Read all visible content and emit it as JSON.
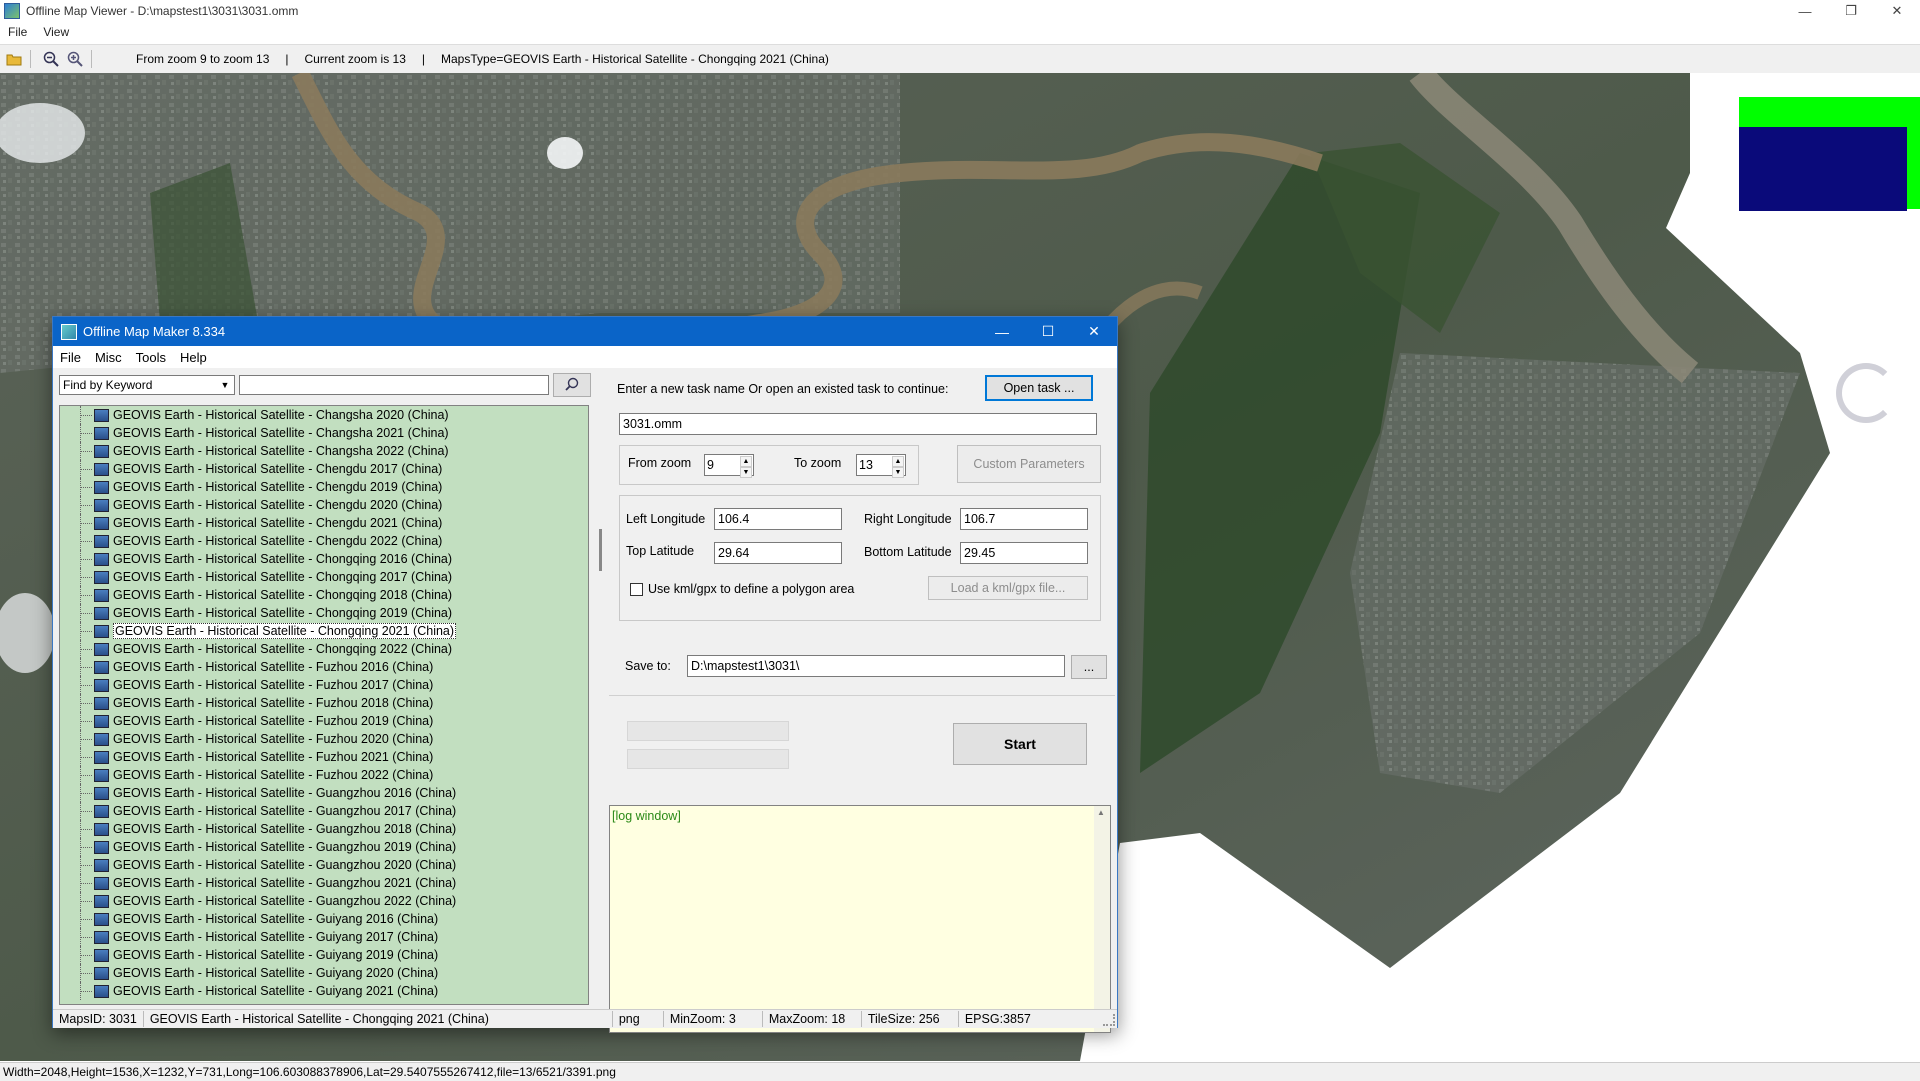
{
  "viewer": {
    "title": "Offline Map Viewer - D:\\mapstest1\\3031\\3031.omm",
    "window_buttons": {
      "minimize": "—",
      "restore": "❐",
      "close": "✕"
    },
    "menu": [
      "File",
      "View"
    ],
    "toolbar": {
      "zoom_range": "From zoom 9 to zoom 13",
      "sep1": "|",
      "current_zoom": "Current zoom is 13",
      "sep2": "|",
      "maps_type": "MapsType=GEOVIS Earth - Historical Satellite - Chongqing 2021 (China)"
    },
    "status": "Width=2048,Height=1536,X=1232,Y=731,Long=106.603088378906,Lat=29.5407555267412,file=13/6521/3391.png"
  },
  "dialog": {
    "title": "Offline Map Maker 8.334",
    "menu": [
      "File",
      "Misc",
      "Tools",
      "Help"
    ],
    "search": {
      "mode": "Find by Keyword",
      "keyword": ""
    },
    "map_list": [
      "GEOVIS Earth - Historical Satellite - Changsha 2020 (China)",
      "GEOVIS Earth - Historical Satellite - Changsha 2021 (China)",
      "GEOVIS Earth - Historical Satellite - Changsha 2022 (China)",
      "GEOVIS Earth - Historical Satellite - Chengdu 2017 (China)",
      "GEOVIS Earth - Historical Satellite - Chengdu 2019 (China)",
      "GEOVIS Earth - Historical Satellite - Chengdu 2020 (China)",
      "GEOVIS Earth - Historical Satellite - Chengdu 2021 (China)",
      "GEOVIS Earth - Historical Satellite - Chengdu 2022 (China)",
      "GEOVIS Earth - Historical Satellite - Chongqing 2016 (China)",
      "GEOVIS Earth - Historical Satellite - Chongqing 2017 (China)",
      "GEOVIS Earth - Historical Satellite - Chongqing 2018 (China)",
      "GEOVIS Earth - Historical Satellite - Chongqing 2019 (China)",
      "GEOVIS Earth - Historical Satellite - Chongqing 2021 (China)",
      "GEOVIS Earth - Historical Satellite - Chongqing 2022 (China)",
      "GEOVIS Earth - Historical Satellite - Fuzhou 2016 (China)",
      "GEOVIS Earth - Historical Satellite - Fuzhou 2017 (China)",
      "GEOVIS Earth - Historical Satellite - Fuzhou 2018 (China)",
      "GEOVIS Earth - Historical Satellite - Fuzhou 2019 (China)",
      "GEOVIS Earth - Historical Satellite - Fuzhou 2020 (China)",
      "GEOVIS Earth - Historical Satellite - Fuzhou 2021 (China)",
      "GEOVIS Earth - Historical Satellite - Fuzhou 2022 (China)",
      "GEOVIS Earth - Historical Satellite - Guangzhou 2016 (China)",
      "GEOVIS Earth - Historical Satellite - Guangzhou 2017 (China)",
      "GEOVIS Earth - Historical Satellite - Guangzhou 2018 (China)",
      "GEOVIS Earth - Historical Satellite - Guangzhou 2019 (China)",
      "GEOVIS Earth - Historical Satellite - Guangzhou 2020 (China)",
      "GEOVIS Earth - Historical Satellite - Guangzhou 2021 (China)",
      "GEOVIS Earth - Historical Satellite - Guangzhou 2022 (China)",
      "GEOVIS Earth - Historical Satellite - Guiyang 2016 (China)",
      "GEOVIS Earth - Historical Satellite - Guiyang 2017 (China)",
      "GEOVIS Earth - Historical Satellite - Guiyang 2019 (China)",
      "GEOVIS Earth - Historical Satellite - Guiyang 2020 (China)",
      "GEOVIS Earth - Historical Satellite - Guiyang 2021 (China)"
    ],
    "selected_index": 12,
    "task": {
      "prompt": "Enter a new task name Or open an existed task to continue:",
      "open_button": "Open task ...",
      "name": "3031.omm"
    },
    "zoom": {
      "from_label": "From zoom",
      "from_value": "9",
      "to_label": "To zoom",
      "to_value": "13",
      "custom_button": "Custom Parameters"
    },
    "area": {
      "left_lon_label": "Left Longitude",
      "left_lon": "106.4",
      "right_lon_label": "Right Longitude",
      "right_lon": "106.7",
      "top_lat_label": "Top Latitude",
      "top_lat": "29.64",
      "bottom_lat_label": "Bottom Latitude",
      "bottom_lat": "29.45",
      "kml_label": "Use kml/gpx to define a polygon area",
      "kml_checked": false,
      "kml_button": "Load a kml/gpx file..."
    },
    "save": {
      "label": "Save to:",
      "path": "D:\\mapstest1\\3031\\",
      "browse": "..."
    },
    "start_button": "Start",
    "log_text": "[log window]",
    "status": {
      "maps_id": "MapsID: 3031",
      "map_name": "GEOVIS Earth - Historical Satellite - Chongqing 2021 (China)",
      "format": "png",
      "min_zoom": "MinZoom: 3",
      "max_zoom": "MaxZoom: 18",
      "tile_size": "TileSize: 256",
      "epsg": "EPSG:3857"
    }
  },
  "colors": {
    "list_bg": "#c2dfc0",
    "dialog_title": "#0a64c8",
    "log_bg": "#ffffe1",
    "log_text": "#2b8a17",
    "legend_outer": "#00ff00",
    "legend_inner": "#0a0a7a"
  }
}
